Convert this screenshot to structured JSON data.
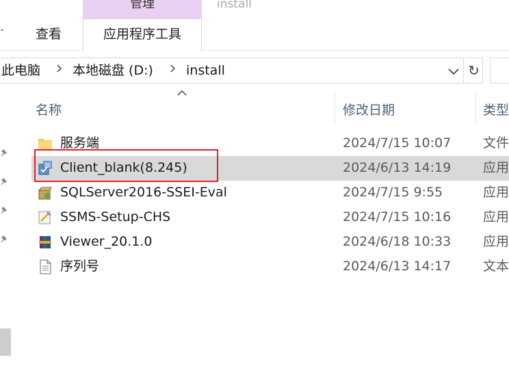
{
  "ribbon": {
    "context_group": "管理",
    "window_title": "install",
    "tabs": [
      {
        "label": "查看"
      },
      {
        "label": "应用程序工具"
      }
    ]
  },
  "address": {
    "crumbs": [
      "此电脑",
      "本地磁盘 (D:)",
      "install"
    ],
    "refresh_glyph": "↻"
  },
  "columns": {
    "name": "名称",
    "date": "修改日期",
    "type": "类型"
  },
  "files": [
    {
      "name": "服务端",
      "date": "2024/7/15 10:07",
      "type": "文件",
      "icon": "folder-icon"
    },
    {
      "name": "Client_blank(8.245)",
      "date": "2024/6/13 14:19",
      "type": "应用",
      "icon": "installer-icon",
      "selected": true
    },
    {
      "name": "SQLServer2016-SSEI-Eval",
      "date": "2024/7/15 9:55",
      "type": "应用",
      "icon": "sql-installer-icon"
    },
    {
      "name": "SSMS-Setup-CHS",
      "date": "2024/7/15 10:16",
      "type": "应用",
      "icon": "ssms-setup-icon"
    },
    {
      "name": "Viewer_20.1.0",
      "date": "2024/6/18 10:33",
      "type": "应用",
      "icon": "archive-app-icon"
    },
    {
      "name": "序列号",
      "date": "2024/6/13 14:17",
      "type": "文本",
      "icon": "text-file-icon"
    }
  ],
  "colors": {
    "context_tab_bg": "#e9d1f4",
    "selection_bg": "#d9d9d9",
    "highlight_border": "#e0212b",
    "header_text": "#4c607a"
  }
}
